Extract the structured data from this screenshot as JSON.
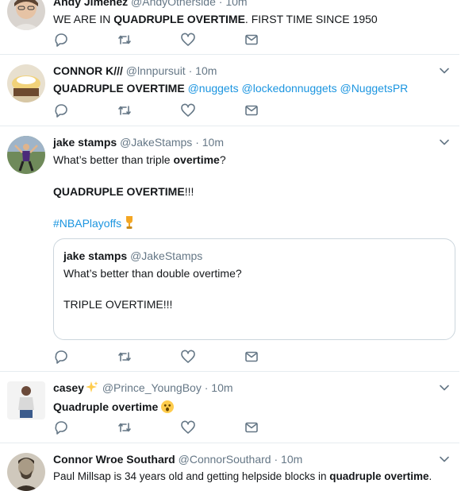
{
  "tweets": [
    {
      "name": "Andy Jimenez",
      "handle": "@AndyOtherside",
      "time": "10m",
      "text_bold": "QUADRUPLE OVERTIME",
      "text_pre": "WE ARE IN ",
      "text_post": ". FIRST TIME SINCE 1950"
    },
    {
      "name": "CONNOR K///",
      "handle": "@lnnpursuit",
      "time": "10m",
      "text_bold": "QUADRUPLE OVERTIME",
      "mentions": [
        "@nuggets",
        "@lockedonnuggets",
        "@NuggetsPR"
      ]
    },
    {
      "name": "jake stamps",
      "handle": "@JakeStamps",
      "time": "10m",
      "line1_pre": "What’s better than triple ",
      "line1_bold": "overtime",
      "line1_post": "?",
      "line2_bold": "QUADRUPLE OVERTIME",
      "line2_post": "!!!",
      "hashtag": "#NBAPlayoffs",
      "quote": {
        "name": "jake stamps",
        "handle": "@JakeStamps",
        "line1": "What’s better than double overtime?",
        "line2": "TRIPLE OVERTIME!!!"
      }
    },
    {
      "name": "casey",
      "handle": "@Prince_YoungBoy",
      "time": "10m",
      "text_bold": "Quadruple overtime"
    },
    {
      "name": "Connor Wroe Southard",
      "handle": "@ConnorSouthard",
      "time": "10m",
      "text_pre": "Paul Millsap is 34 years old and getting helpside blocks in ",
      "text_bold": "quadruple overtime",
      "text_post": "."
    }
  ],
  "ui": {
    "dot": "·"
  },
  "colors": {
    "link": "#1b95e0",
    "muted": "#657786",
    "divider": "#e6ecf0"
  },
  "icons": [
    "reply-icon",
    "retweet-icon",
    "like-icon",
    "message-icon",
    "chevron-down-icon"
  ]
}
